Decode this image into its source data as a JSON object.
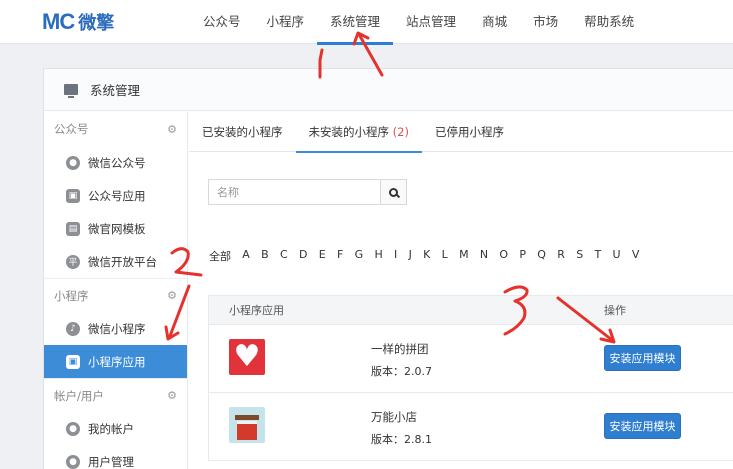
{
  "brand": {
    "logo_mark": "MC",
    "logo_text": "微擎",
    "color": "#2b6cbf"
  },
  "nav": {
    "items": [
      {
        "label": "公众号"
      },
      {
        "label": "小程序"
      },
      {
        "label": "系统管理",
        "active": true
      },
      {
        "label": "站点管理"
      },
      {
        "label": "商城"
      },
      {
        "label": "市场"
      },
      {
        "label": "帮助系统"
      }
    ]
  },
  "panel": {
    "title": "系统管理",
    "icon": "monitor-icon"
  },
  "sidebar": {
    "groups": [
      {
        "label": "公众号",
        "items": [
          {
            "label": "微信公众号",
            "icon": "wechat-icon"
          },
          {
            "label": "公众号应用",
            "icon": "app-icon"
          },
          {
            "label": "微官网模板",
            "icon": "template-icon"
          },
          {
            "label": "微信开放平台",
            "icon": "platform-icon"
          }
        ]
      },
      {
        "label": "小程序",
        "items": [
          {
            "label": "微信小程序",
            "icon": "miniprogram-icon"
          },
          {
            "label": "小程序应用",
            "icon": "app-icon",
            "active": true
          }
        ]
      },
      {
        "label": "帐户/用户",
        "items": [
          {
            "label": "我的帐户",
            "icon": "user-icon"
          },
          {
            "label": "用户管理",
            "icon": "users-icon"
          }
        ]
      }
    ]
  },
  "tabs": [
    {
      "label": "已安装的小程序"
    },
    {
      "label": "未安装的小程序",
      "count": "(2)",
      "active": true
    },
    {
      "label": "已停用小程序"
    }
  ],
  "search": {
    "placeholder": "名称",
    "value": ""
  },
  "letters": [
    "全部",
    "A",
    "B",
    "C",
    "D",
    "E",
    "F",
    "G",
    "H",
    "I",
    "J",
    "K",
    "L",
    "M",
    "N",
    "O",
    "P",
    "Q",
    "R",
    "S",
    "T",
    "U",
    "V"
  ],
  "table": {
    "headers": {
      "app": "小程序应用",
      "op": "操作"
    },
    "rows": [
      {
        "name": "一样的拼团",
        "version": "版本：2.0.7",
        "button": "安装应用模块",
        "thumb": "heart"
      },
      {
        "name": "万能小店",
        "version": "版本：2.8.1",
        "button": "安装应用模块",
        "thumb": "shop"
      }
    ]
  },
  "colors": {
    "accent": "#3c8cd8",
    "annotation": "#e5322d",
    "count": "#d9534f"
  }
}
